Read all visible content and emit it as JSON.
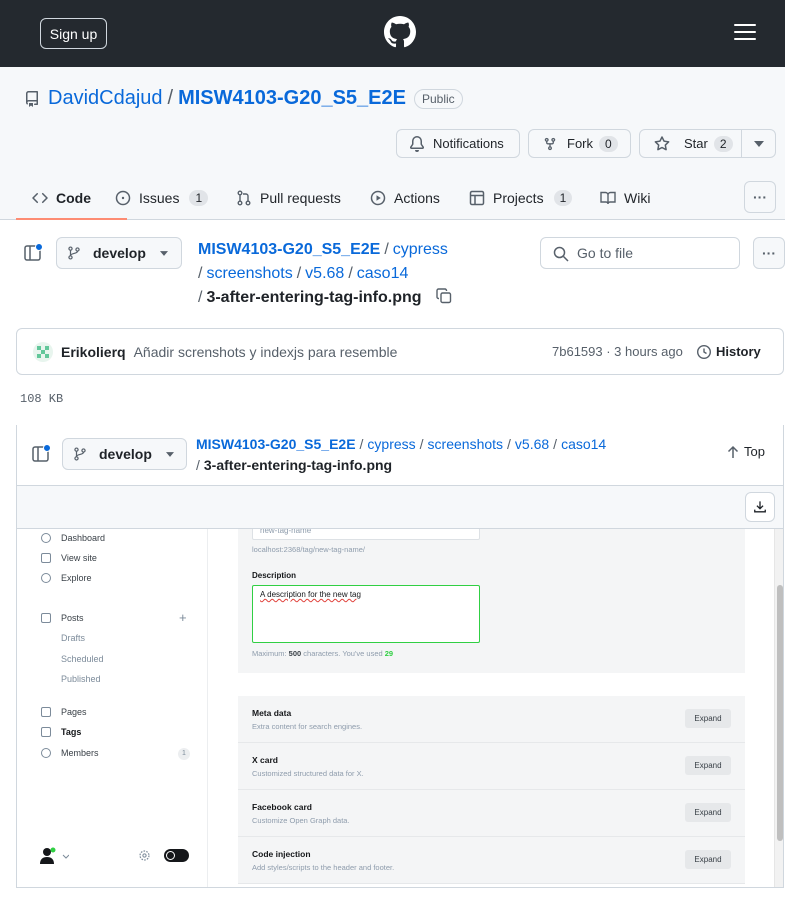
{
  "header": {
    "signup_label": "Sign up"
  },
  "repo": {
    "owner": "DavidCdajud",
    "separator": "/",
    "name": "MISW4103-G20_S5_E2E",
    "visibility": "Public",
    "notifications_label": "Notifications",
    "fork_label": "Fork",
    "fork_count": "0",
    "star_label": "Star",
    "star_count": "2"
  },
  "tabs": [
    {
      "label": "Code",
      "count": ""
    },
    {
      "label": "Issues",
      "count": "1"
    },
    {
      "label": "Pull requests",
      "count": ""
    },
    {
      "label": "Actions",
      "count": ""
    },
    {
      "label": "Projects",
      "count": "1"
    },
    {
      "label": "Wiki",
      "count": ""
    }
  ],
  "filenav": {
    "branch": "develop",
    "breadcrumbs": [
      "MISW4103-G20_S5_E2E",
      "cypress",
      "screenshots",
      "v5.68",
      "caso14"
    ],
    "filename": "3-after-entering-tag-info.png",
    "goto_placeholder": "Go to file"
  },
  "commit": {
    "author": "Erikolierq",
    "message": "Añadir screnshots y indexjs para resemble",
    "sha_time": "7b61593 · 3 hours ago",
    "history_label": "History"
  },
  "file_size": "108 KB",
  "sticky": {
    "branch": "develop",
    "top_label": "Top"
  },
  "screenshot": {
    "nav": {
      "dashboard": "Dashboard",
      "view_site": "View site",
      "explore": "Explore",
      "posts": "Posts",
      "drafts": "Drafts",
      "scheduled": "Scheduled",
      "published": "Published",
      "pages": "Pages",
      "tags": "Tags",
      "members": "Members",
      "members_count": "1"
    },
    "slug_value": "new-tag-name",
    "url_hint": "localhost:2368/tag/new-tag-name/",
    "description_label": "Description",
    "description_value": "A description for the new tag",
    "counter_prefix": "Maximum: ",
    "counter_max": "500",
    "counter_mid": " characters. You've used ",
    "counter_used": "29",
    "sections": [
      {
        "title": "Meta data",
        "desc": "Extra content for search engines.",
        "button": "Expand"
      },
      {
        "title": "X card",
        "desc": "Customized structured data for X.",
        "button": "Expand"
      },
      {
        "title": "Facebook card",
        "desc": "Customize Open Graph data.",
        "button": "Expand"
      },
      {
        "title": "Code injection",
        "desc": "Add styles/scripts to the header and footer.",
        "button": "Expand"
      }
    ]
  },
  "colors": {
    "topbar": "#24292f",
    "link": "#0969da",
    "accent_underline": "#fd8c73",
    "ghost_green": "#30cf43"
  }
}
